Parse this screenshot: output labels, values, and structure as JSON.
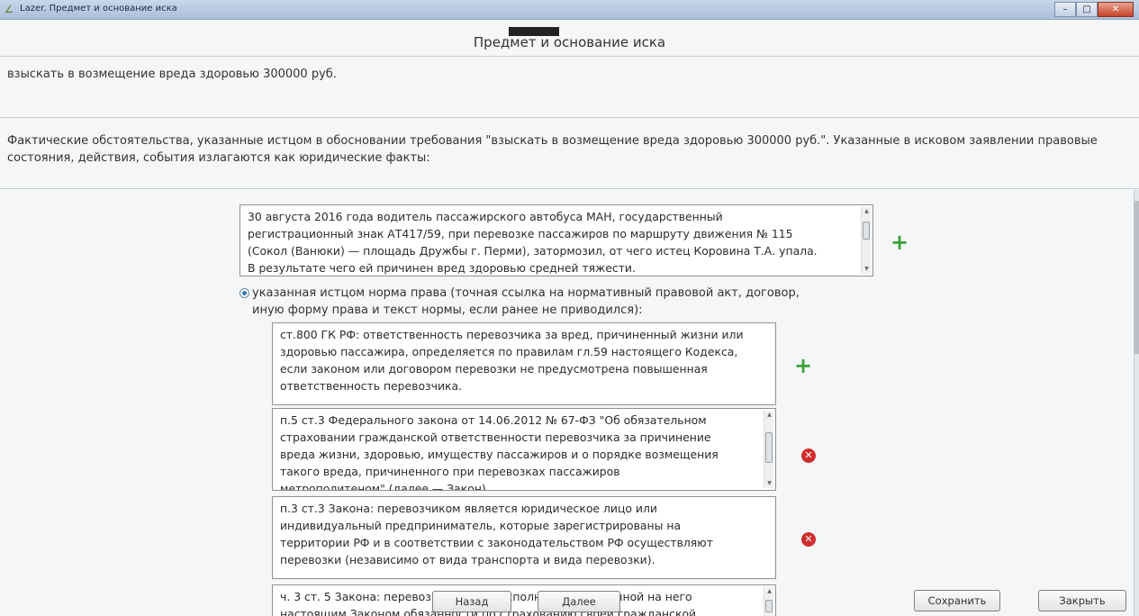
{
  "window": {
    "app_title": "Lazer. Предмет и основание иска",
    "minimize_label": "–",
    "maximize_label": "□",
    "close_label": "✕"
  },
  "header": {
    "title": "Предмет и основание иска"
  },
  "claim": {
    "text": "взыскать в возмещение вреда здоровью 300000 руб."
  },
  "facts_intro": {
    "line1": "Фактические обстоятельства, указанные истцом в обосновании требования \"взыскать в возмещение вреда здоровью 300000 руб.\". Указанные в исковом заявлении правовые",
    "line2": "состояния, действия, события излагаются как юридические факты:"
  },
  "fact_box": {
    "lines": [
      "30 августа 2016 года водитель пассажирского автобуса МАН, государственный",
      "регистрационный знак АТ417/59, при перевозке пассажиров по маршруту движения № 115",
      "(Сокол (Ванюки) — площадь Дружбы г. Перми),  затормозил, от чего истец Коровина Т.А. упала.",
      "В результате чего ей причинен вред здоровью средней тяжести."
    ],
    "scroll_position": 0.2
  },
  "norm_option": {
    "label_line1": "указанная истцом норма права (точная ссылка на нормативный правовой акт, договор,",
    "label_line2": "иную форму права и текст нормы, если ранее не приводился):",
    "selected": true
  },
  "norms": [
    {
      "lines": [
        "ст.800 ГК РФ: ответственность перевозчика за вред, причиненный жизни или",
        "здоровью пассажира, определяется по правилам гл.59 настоящего Кодекса,",
        "если законом или договором перевозки не предусмотрена повышенная",
        "ответственность перевозчика."
      ]
    },
    {
      "lines": [
        "п.5 ст.3 Федерального закона от 14.06.2012 № 67-ФЗ \"Об обязательном",
        "страховании гражданской ответственности перевозчика за причинение",
        "вреда жизни, здоровью, имуществу пассажиров и о порядке возмещения",
        "такого вреда, причиненного при перевозках пассажиров",
        "метрополитеном\" (далее — Закон)"
      ],
      "scroll_position": 0.5
    },
    {
      "lines": [
        "п.3 ст.3 Закона: перевозчиком является юридическое лицо или",
        "индивидуальный предприниматель, которые зарегистрированы на",
        "территории РФ и в соответствии с законодательством РФ осуществляют",
        "перевозки (независимо от вида транспорта и вида перевозки)."
      ]
    },
    {
      "lines": [
        "ч. 3 ст. 5 Закона: перевозчик обязан исполнить возложенной на него",
        "настоящим Законом обязанности по страхованию своей гражданской"
      ],
      "scroll_position": 0.3
    }
  ],
  "buttons": {
    "back": "Назад",
    "next": "Далее",
    "save": "Сохранить",
    "close": "Закрыть"
  },
  "icons": {
    "add": "plus-icon",
    "remove": "remove-icon"
  },
  "colors": {
    "add": "#3aa13b",
    "remove": "#cf2d2d",
    "title_bar": "#b7c9df"
  }
}
